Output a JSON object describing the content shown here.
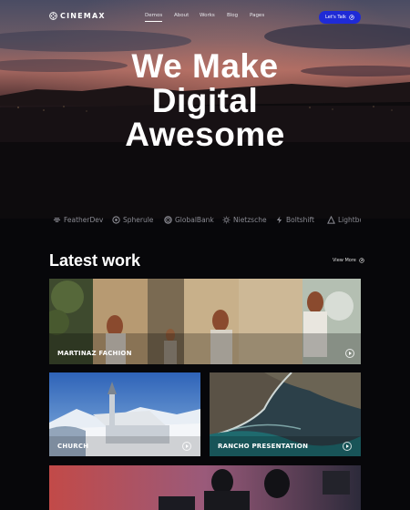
{
  "brand": {
    "name": "CINEMAX",
    "logo_icon": "film-reel-icon"
  },
  "nav": {
    "items": [
      {
        "label": "Demos",
        "active": true
      },
      {
        "label": "About",
        "active": false
      },
      {
        "label": "Works",
        "active": false
      },
      {
        "label": "Blog",
        "active": false
      },
      {
        "label": "Pages",
        "active": false
      }
    ],
    "cta_label": "Let's Talk",
    "cta_icon": "arrow-circle-icon",
    "cta_color": "#1f2bd6"
  },
  "hero": {
    "lines": [
      "We Make",
      "Digital",
      "Awesome"
    ]
  },
  "partners": [
    {
      "name": "FeatherDev",
      "icon": "feather-icon"
    },
    {
      "name": "Spherule",
      "icon": "sphere-icon"
    },
    {
      "name": "GlobalBank",
      "icon": "globe-icon"
    },
    {
      "name": "Nietzsche",
      "icon": "sun-icon"
    },
    {
      "name": "Boltshift",
      "icon": "bolt-icon"
    },
    {
      "name": "Lightbo",
      "icon": "light-icon"
    }
  ],
  "works": {
    "title": "Latest work",
    "view_more_label": "View More",
    "items": [
      {
        "title": "MARTINAZ FACHION"
      },
      {
        "title": "CHURCH"
      },
      {
        "title": "RANCHO PRESENTATION"
      }
    ]
  }
}
